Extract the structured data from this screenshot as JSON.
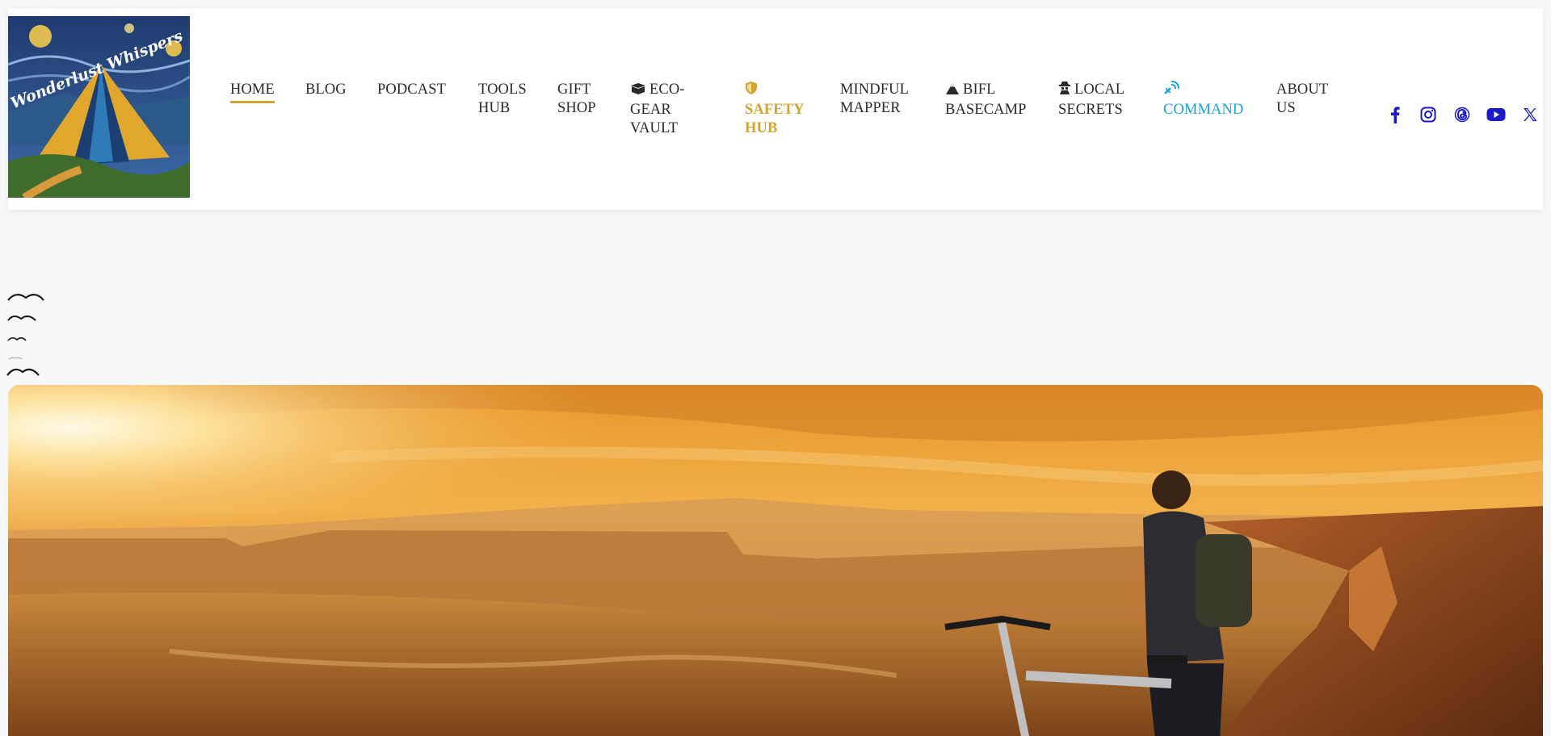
{
  "logo": {
    "text": "Wonderlust Whispers"
  },
  "nav": {
    "home": "HOME",
    "blog": "BLOG",
    "podcast": "PODCAST",
    "tools_hub": "TOOLS HUB",
    "gift_shop": "GIFT SHOP",
    "eco_gear_vault": "ECO-GEAR VAULT",
    "safety_hub": "SAFETY HUB",
    "mindful_mapper": "MINDFUL MAPPER",
    "bifl_basecamp": "BIFL BASECAMP",
    "local_secrets": "LOCAL SECRETS",
    "command": "COMMAND",
    "about_us": "ABOUT US"
  },
  "social": [
    "facebook-icon",
    "instagram-icon",
    "threads-icon",
    "youtube-icon",
    "x-icon"
  ],
  "colors": {
    "accent_gold": "#d1a530",
    "command_blue": "#1aa3d8",
    "social_blue": "#1a1ac8",
    "page_bg": "#f7f8fa"
  }
}
